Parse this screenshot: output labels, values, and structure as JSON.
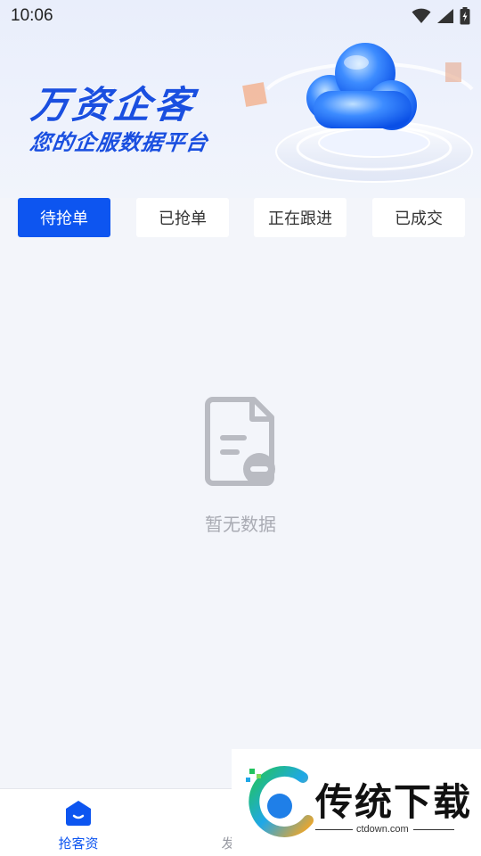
{
  "status_bar": {
    "time": "10:06"
  },
  "banner": {
    "title": "万资企客",
    "subtitle": "您的企服数据平台"
  },
  "tabs": [
    {
      "label": "待抢单",
      "active": true
    },
    {
      "label": "已抢单",
      "active": false
    },
    {
      "label": "正在跟进",
      "active": false
    },
    {
      "label": "已成交",
      "active": false
    }
  ],
  "empty_state": {
    "text": "暂无数据"
  },
  "bottom_nav": [
    {
      "label": "抢客资",
      "active": true,
      "icon": "home-icon"
    },
    {
      "label": "发",
      "active": false,
      "icon": "publish-icon"
    }
  ],
  "watermark": {
    "brand": "传统下载",
    "url": "ctdown.com"
  },
  "colors": {
    "accent": "#0d55f0",
    "background": "#f3f5fa",
    "muted_text": "#a9abb3"
  }
}
